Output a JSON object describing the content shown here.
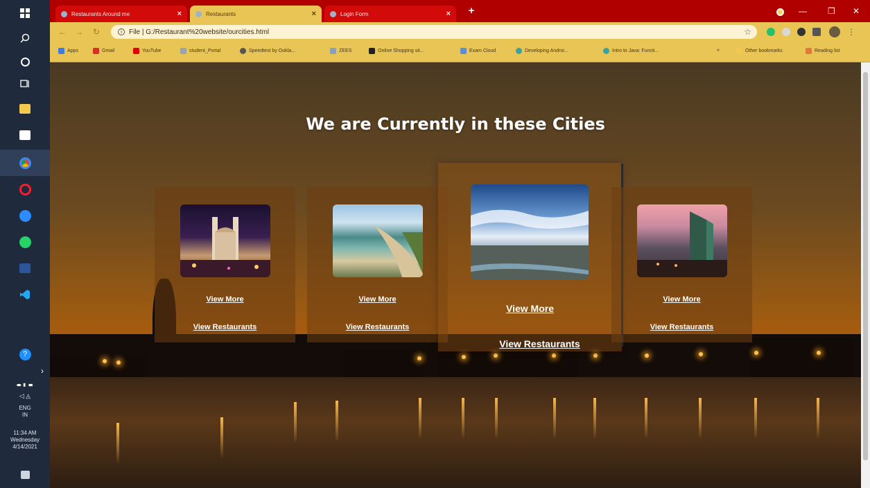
{
  "browser": {
    "tabs": [
      {
        "title": "Restaurants Around me",
        "active": false
      },
      {
        "title": "Restaurants",
        "active": true
      },
      {
        "title": "Login Form",
        "active": false
      }
    ],
    "address": "File  |  G:/Restaurant%20website/ourcities.html",
    "bookmarks": [
      {
        "label": "Apps",
        "color": "#3d7be0"
      },
      {
        "label": "Gmail",
        "color": "#d93025"
      },
      {
        "label": "YouTube",
        "color": "#e00000"
      },
      {
        "label": "student_Portal",
        "color": "#9aa4ad"
      },
      {
        "label": "Speedtest by Ookla...",
        "color": "#555555"
      },
      {
        "label": "ZEES",
        "color": "#8aa0b8"
      },
      {
        "label": "Online Shopping sit...",
        "color": "#222222"
      },
      {
        "label": "Exam Cloud",
        "color": "#5a8fd6"
      },
      {
        "label": "Developing Androi...",
        "color": "#3aa0a0"
      },
      {
        "label": "Intro to Java: Functi...",
        "color": "#3aa0a0"
      }
    ],
    "other_bookmarks": "Other bookmarks",
    "reading_list": "Reading list"
  },
  "taskbar": {
    "time": "11:34 AM",
    "day": "Wednesday",
    "date": "4/14/2021",
    "lang1": "ENG",
    "lang2": "IN"
  },
  "page": {
    "title": "We are Currently in these Cities",
    "cards": [
      {
        "name": "hyderabad",
        "view_more": "View More",
        "view_restaurants": "View Restaurants"
      },
      {
        "name": "beach",
        "view_more": "View More",
        "view_restaurants": "View Restaurants"
      },
      {
        "name": "cityscape",
        "view_more": "View More",
        "view_restaurants": "View Restaurants"
      },
      {
        "name": "skyscraper",
        "view_more": "View More",
        "view_restaurants": "View Restaurants"
      }
    ]
  }
}
